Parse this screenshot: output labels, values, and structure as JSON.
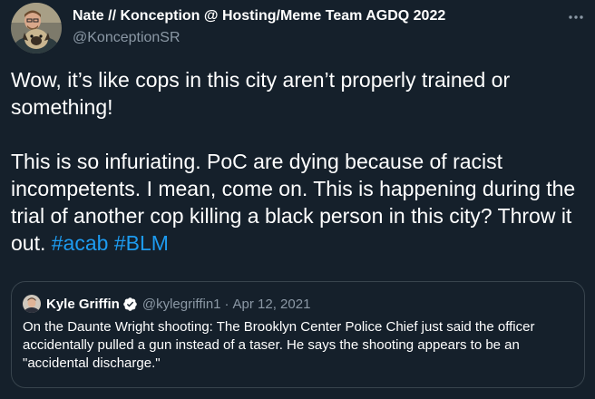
{
  "colors": {
    "background": "#15202b",
    "text_primary": "#ffffff",
    "text_secondary": "#8b98a5",
    "link": "#1d9bf0",
    "border": "#38444d",
    "verified_badge": "#ffffff"
  },
  "author": {
    "display_name": "Nate // Konception @ Hosting/Meme Team AGDQ 2022",
    "handle": "@KonceptionSR",
    "avatar_icon": "profile-photo-with-dog"
  },
  "menu": {
    "icon": "more-horizontal-icon"
  },
  "tweet": {
    "paragraph_1": "Wow, it’s like cops in this city aren’t properly trained or something!",
    "paragraph_2_text": "This is so infuriating. PoC are dying because of racist incompetents. I mean, come on. This is happening during the trial of another cop killing a black person in this city? Throw it out.",
    "hashtags": [
      "#acab",
      "#BLM"
    ]
  },
  "quote": {
    "display_name": "Kyle Griffin",
    "verified_icon": "verified-badge-icon",
    "handle": "@kylegriffin1",
    "separator": "·",
    "date": "Apr 12, 2021",
    "text": "On the Daunte Wright shooting: The Brooklyn Center Police Chief just said the officer accidentally pulled a gun instead of a taser. He says the shooting appears to be an \"accidental discharge.\""
  }
}
